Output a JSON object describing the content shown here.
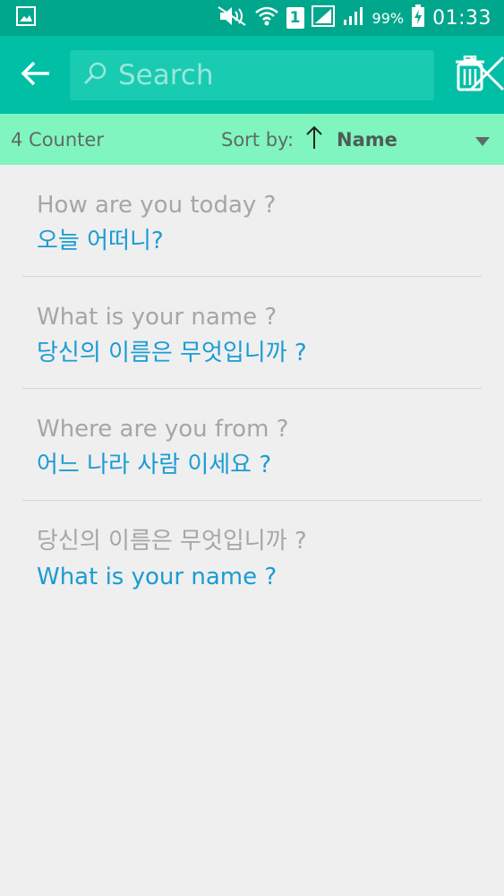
{
  "status_bar": {
    "battery": "99%",
    "sim": "1",
    "time": "01:33"
  },
  "app_bar": {
    "search_placeholder": "Search",
    "search_value": ""
  },
  "sort_bar": {
    "counter": "4 Counter",
    "sort_label": "Sort by:",
    "sort_value": "Name"
  },
  "items": [
    {
      "primary": "How are you today ?",
      "secondary": "오늘 어떠니?"
    },
    {
      "primary": "What is your name ?",
      "secondary": "당신의 이름은 무엇입니까 ?"
    },
    {
      "primary": "Where are you from ?",
      "secondary": "어느 나라 사람 이세요 ?"
    },
    {
      "primary": "당신의 이름은 무엇입니까 ?",
      "secondary": "What is your name ?"
    }
  ],
  "colors": {
    "status_bar": "#00a78c",
    "app_bar": "#00bfa5",
    "sort_bar": "#80f5c0",
    "background": "#efeff0",
    "primary_text": "#a6a6a6",
    "secondary_text": "#1a9cd2"
  },
  "icons": {
    "status": [
      "gallery-icon",
      "mute-icon",
      "wifi-icon",
      "sim-icon",
      "signal-icon",
      "signal-icon",
      "battery-charging-icon"
    ],
    "app_bar": [
      "back-arrow-icon",
      "search-icon",
      "close-icon",
      "trash-icon"
    ],
    "sort_bar": [
      "sort-ascending-icon",
      "dropdown-arrow-icon"
    ]
  }
}
